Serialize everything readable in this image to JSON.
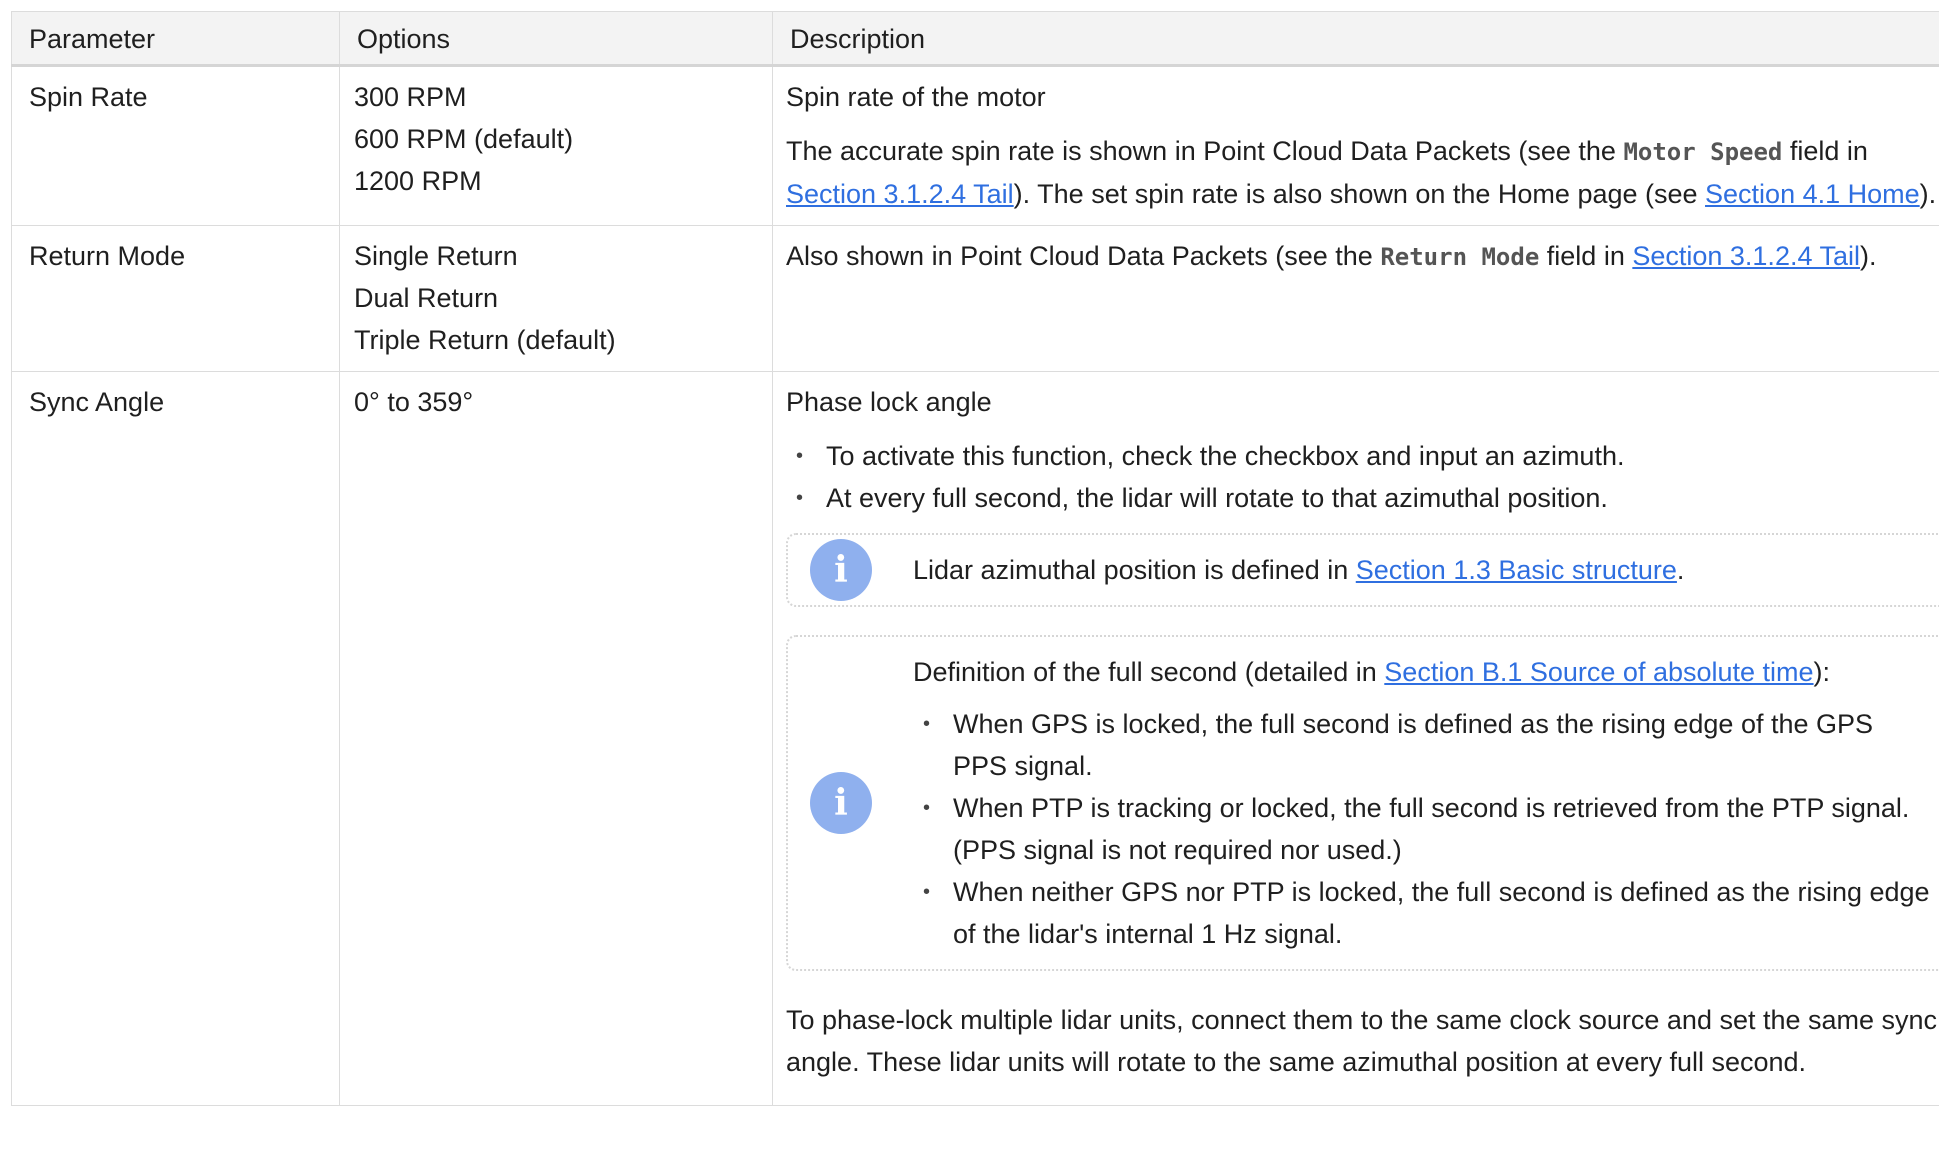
{
  "table": {
    "headers": [
      "Parameter",
      "Options",
      "Description"
    ],
    "rows": [
      {
        "parameter": "Spin Rate",
        "options": [
          "300 RPM",
          "600 RPM (default)",
          "1200 RPM"
        ],
        "desc_title": "Spin rate of the motor",
        "desc_p1": "The accurate spin rate is shown in Point Cloud Data Packets (see the ",
        "desc_code": "Motor Speed",
        "desc_p2": " field in ",
        "desc_link1": "Section 3.1.2.4 Tail",
        "desc_p3": "). The set spin rate is also shown on the Home page (see ",
        "desc_link2": "Section 4.1 Home",
        "desc_p4": ")."
      },
      {
        "parameter": "Return Mode",
        "options": [
          "Single Return",
          "Dual Return",
          "Triple Return (default)"
        ],
        "desc_p1": "Also shown in Point Cloud Data Packets (see the ",
        "desc_code": "Return Mode",
        "desc_p2": " field in ",
        "desc_link1": "Section 3.1.2.4 Tail",
        "desc_p3": ")."
      },
      {
        "parameter": "Sync Angle",
        "options": [
          "0° to 359°"
        ],
        "desc_title": "Phase lock angle",
        "bullets": [
          "To activate this function, check the checkbox and input an azimuth.",
          "At every full second, the lidar will rotate to that azimuthal position."
        ],
        "note1": {
          "icon": "info-icon",
          "text": "Lidar azimuthal position is defined in ",
          "link": "Section 1.3 Basic structure",
          "tail": "."
        },
        "note2": {
          "icon": "info-icon",
          "text": "Definition of the full second (detailed in ",
          "link": "Section B.1 Source of absolute time",
          "tail": "):",
          "bullets": [
            "When GPS is locked, the full second is defined as the rising edge of the GPS PPS signal.",
            "When PTP is tracking or locked, the full second is retrieved from the PTP signal. (PPS signal is not required nor used.)",
            "When neither GPS nor PTP is locked, the full second is defined as the rising edge of the lidar's internal 1 Hz signal."
          ]
        },
        "closing": "To phase-lock multiple lidar units, connect them to the same clock source and set the same sync angle. These lidar units will rotate to the same azimuthal position at every full second."
      }
    ]
  },
  "colors": {
    "link": "#2f6fe0",
    "icon_bg": "#8fb0ee",
    "header_bg": "#f3f3f3",
    "border": "#dcdcdc"
  }
}
